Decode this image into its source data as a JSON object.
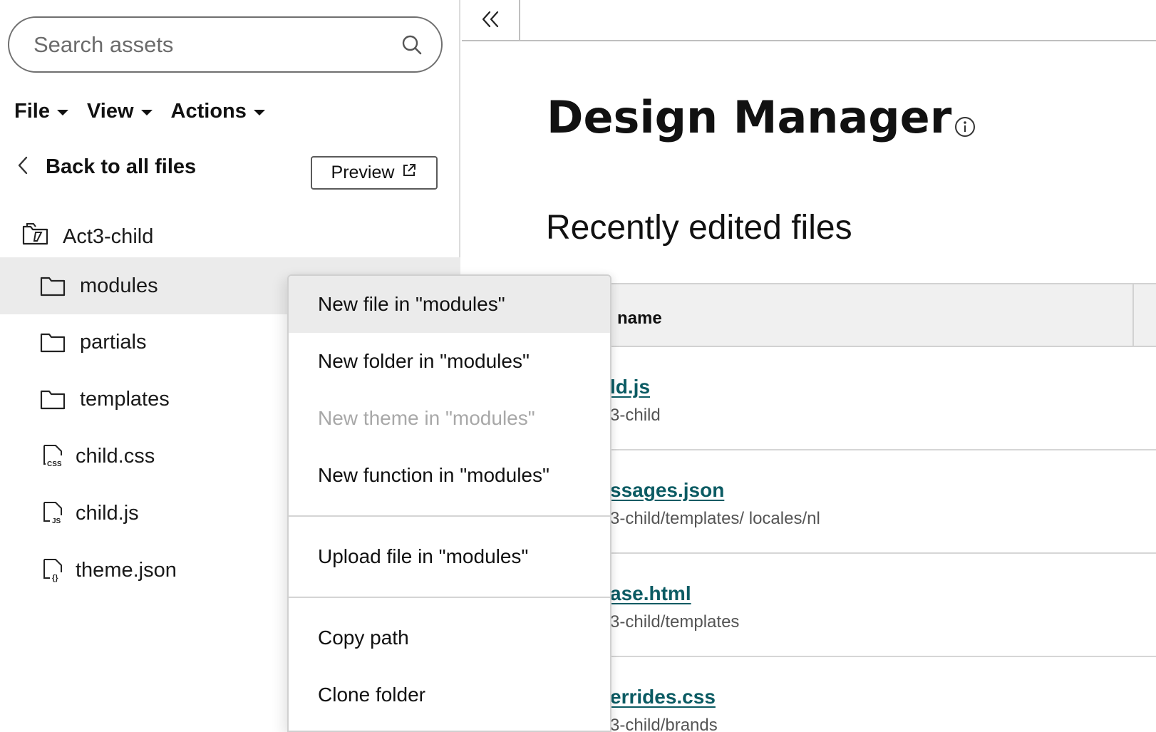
{
  "search": {
    "placeholder": "Search assets"
  },
  "menubar": {
    "file": "File",
    "view": "View",
    "actions": "Actions"
  },
  "nav": {
    "back_label": "Back to all files",
    "preview_label": "Preview"
  },
  "tree": {
    "root": "Act3-child",
    "items": [
      {
        "label": "modules",
        "type": "folder",
        "selected": true
      },
      {
        "label": "partials",
        "type": "folder"
      },
      {
        "label": "templates",
        "type": "folder"
      },
      {
        "label": "child.css",
        "type": "css-file"
      },
      {
        "label": "child.js",
        "type": "js-file"
      },
      {
        "label": "theme.json",
        "type": "json-file"
      }
    ]
  },
  "main": {
    "title": "Design Manager",
    "section_title": "Recently edited files",
    "table": {
      "column": "name",
      "rows": [
        {
          "name": "ld.js",
          "path": "3-child"
        },
        {
          "name": "ssages.json",
          "path": "3-child/templates/ locales/nl"
        },
        {
          "name": "ase.html",
          "path": "3-child/templates"
        },
        {
          "name": "errides.css",
          "path": "3-child/brands"
        }
      ]
    }
  },
  "context_menu": {
    "items": [
      {
        "label": "New file in \"modules\"",
        "state": "hover"
      },
      {
        "label": "New folder in \"modules\""
      },
      {
        "label": "New theme in \"modules\"",
        "state": "disabled"
      },
      {
        "label": "New function in \"modules\""
      },
      {
        "label": "Upload file in \"modules\""
      },
      {
        "label": "Copy path"
      },
      {
        "label": "Clone folder"
      }
    ]
  },
  "colors": {
    "link": "#0b5b63",
    "selected_bg": "#ebebeb",
    "disabled_text": "#a8a8a8"
  }
}
